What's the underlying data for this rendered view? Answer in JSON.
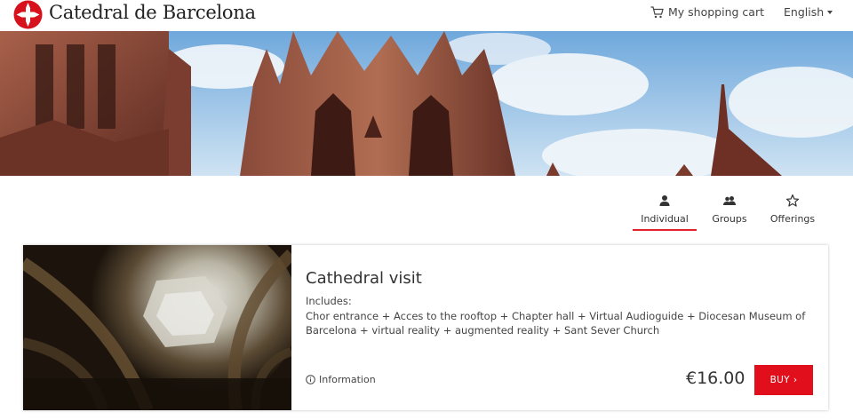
{
  "header": {
    "brand": "Catedral de Barcelona",
    "cart_label": "My shopping cart",
    "language_label": "English",
    "cart_icon": "shopping-cart-icon",
    "logo_icon": "cross-logo-icon"
  },
  "tabs": [
    {
      "label": "Individual",
      "icon": "person-icon",
      "active": true
    },
    {
      "label": "Groups",
      "icon": "people-icon",
      "active": false
    },
    {
      "label": "Offerings",
      "icon": "star-icon",
      "active": false
    }
  ],
  "product": {
    "title": "Cathedral visit",
    "includes_label": "Includes:",
    "includes_text": "Chor entrance + Acces to the rooftop + Chapter hall + Virtual Audioguide + Diocesan Museum of Barcelona + virtual reality + augmented reality + Sant Sever Church",
    "info_label": "Information",
    "price": "€16.00",
    "buy_label": "BUY"
  },
  "colors": {
    "accent": "#e10f1b",
    "tab_underline": "#e1232f"
  }
}
